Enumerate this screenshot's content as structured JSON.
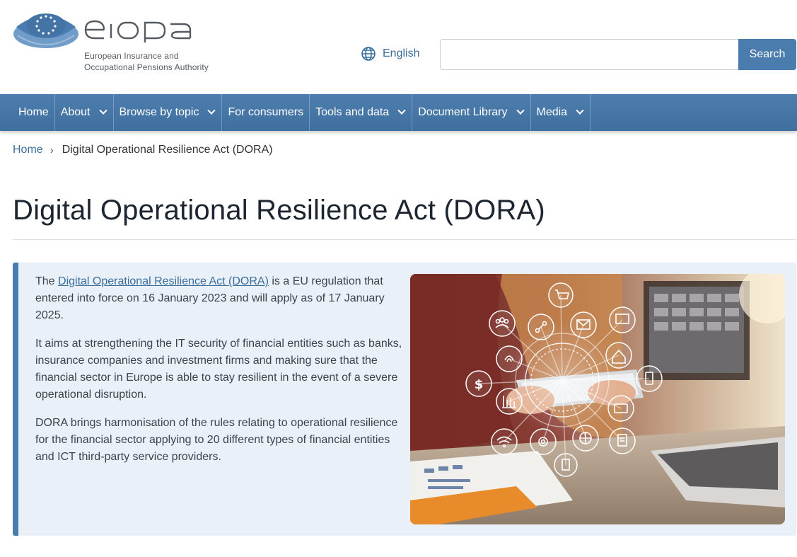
{
  "header": {
    "logo_wordmark": "eiopa",
    "logo_subtitle_line1": "European Insurance and",
    "logo_subtitle_line2": "Occupational Pensions Authority",
    "language_label": "English",
    "search_placeholder": "",
    "search_button_label": "Search"
  },
  "nav": {
    "items": [
      {
        "label": "Home",
        "has_dropdown": false
      },
      {
        "label": "About",
        "has_dropdown": true
      },
      {
        "label": "Browse by topic",
        "has_dropdown": true
      },
      {
        "label": "For consumers",
        "has_dropdown": false
      },
      {
        "label": "Tools and data",
        "has_dropdown": true
      },
      {
        "label": "Document Library",
        "has_dropdown": true
      },
      {
        "label": "Media",
        "has_dropdown": true
      }
    ]
  },
  "breadcrumb": {
    "home": "Home",
    "separator": "›",
    "current": "Digital Operational Resilience Act (DORA)"
  },
  "page": {
    "title": "Digital Operational Resilience Act (DORA)"
  },
  "content": {
    "p1_prefix": "The ",
    "p1_link": "Digital Operational Resilience Act (DORA)",
    "p1_suffix": " is a EU regulation that entered into force on 16 January 2023 and will apply as of 17 January 2025.",
    "p2": "It aims at strengthening the IT security of financial entities such as banks, insurance companies and investment firms and making sure that the financial sector in Europe is able to stay resilient in the event of a severe operational disruption.",
    "p3": "DORA brings harmonisation of the rules relating to operational resilience for the financial sector applying to 20 different types of financial entities and ICT third-party service providers.",
    "image_icons": [
      "shopping-cart-icon",
      "people-icon",
      "share-icon",
      "mail-icon",
      "chat-icon",
      "fingerprint-icon",
      "home-icon",
      "dollar-icon",
      "tablet-icon",
      "bar-chart-icon",
      "card-icon",
      "wifi-icon",
      "gear-icon",
      "globe-icon",
      "document-icon"
    ]
  },
  "colors": {
    "brand_blue": "#4b7cae",
    "nav_blue": "#46769f",
    "link_blue": "#3a6d9c",
    "panel_bg": "#eaf0f7"
  }
}
